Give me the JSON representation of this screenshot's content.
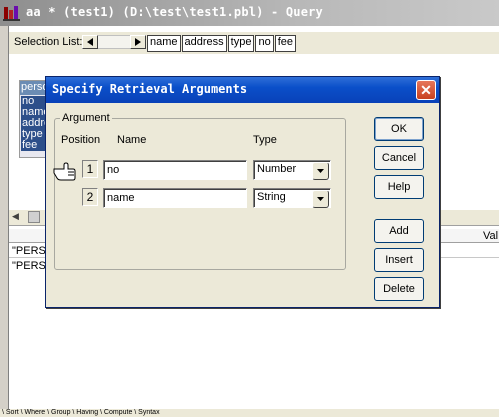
{
  "window": {
    "title": "aa * (test1) (D:\\test\\test1.pbl) - Query"
  },
  "selection": {
    "label": "Selection List:",
    "tokens": [
      "name",
      "address",
      "type",
      "no",
      "fee"
    ]
  },
  "table": {
    "header": "person",
    "columns": [
      "no",
      "name",
      "address",
      "type",
      "fee"
    ]
  },
  "lower": {
    "column_header": "Val",
    "rows": [
      "\"PERS",
      "\"PERS"
    ]
  },
  "bottom_tabs": "\\ Sort \\ Where \\ Group \\ Having \\ Compute \\ Syntax",
  "dialog": {
    "title": "Specify Retrieval Arguments",
    "group_label": "Argument",
    "headers": {
      "position": "Position",
      "name": "Name",
      "type": "Type"
    },
    "args": [
      {
        "position": "1",
        "name": "no",
        "type": "Number"
      },
      {
        "position": "2",
        "name": "name",
        "type": "String"
      }
    ],
    "buttons": {
      "ok": "OK",
      "cancel": "Cancel",
      "help": "Help",
      "add": "Add",
      "insert": "Insert",
      "delete": "Delete"
    }
  },
  "colors": {
    "dialog_title": "#0a4fc9",
    "close_button": "#c8401f",
    "selected_column_bg": "#2d4f8a"
  },
  "icons": {
    "app": "sql-app-icon",
    "pointer": "hand-pointer-icon",
    "close": "close-icon",
    "dropdown": "chevron-down-icon"
  }
}
